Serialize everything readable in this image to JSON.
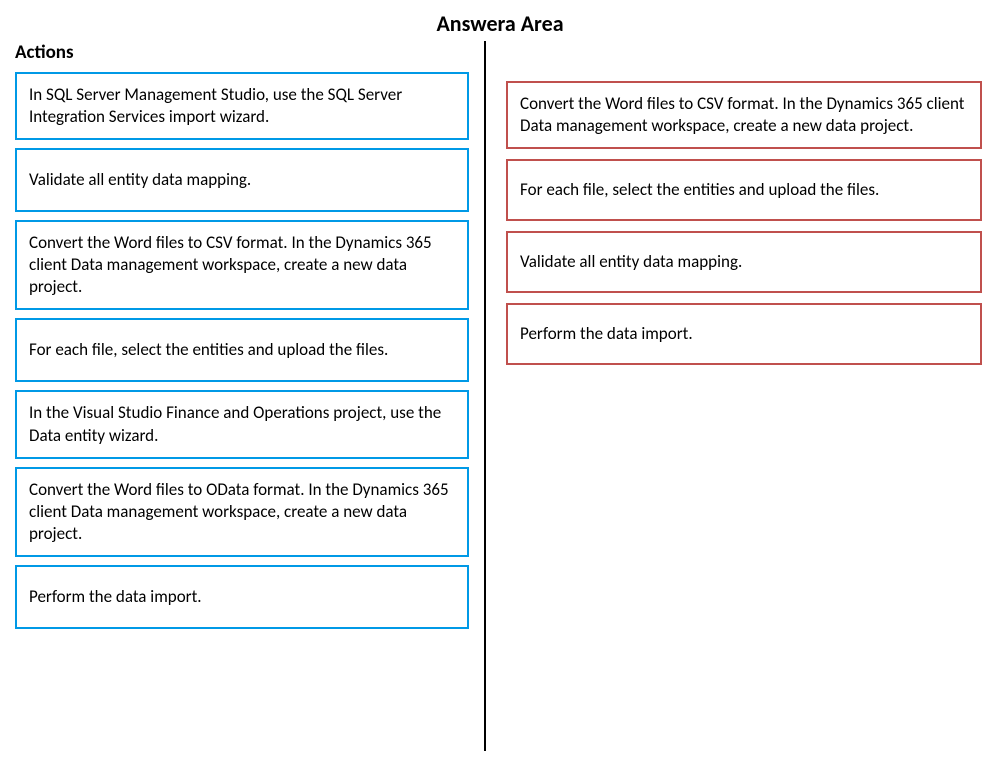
{
  "page_title": "Answera Area",
  "left": {
    "heading": "Actions",
    "items": [
      "In SQL Server Management Studio, use the SQL Server Integration Services import wizard.",
      "Validate all entity data mapping.",
      "Convert the Word files to CSV format. In the Dynamics 365 client Data management workspace, create a new data project.",
      "For each file, select the entities and upload the files.",
      "In the Visual Studio Finance and Operations project, use the Data entity wizard.",
      "Convert the Word files to OData format. In the Dynamics 365 client Data management workspace, create a new data project.",
      "Perform the data import."
    ]
  },
  "right": {
    "items": [
      "Convert the Word files to CSV format. In the Dynamics 365 client Data management workspace, create a new data project.",
      "For each file, select the entities and upload the files.",
      "Validate all entity data mapping.",
      "Perform the data import."
    ]
  }
}
